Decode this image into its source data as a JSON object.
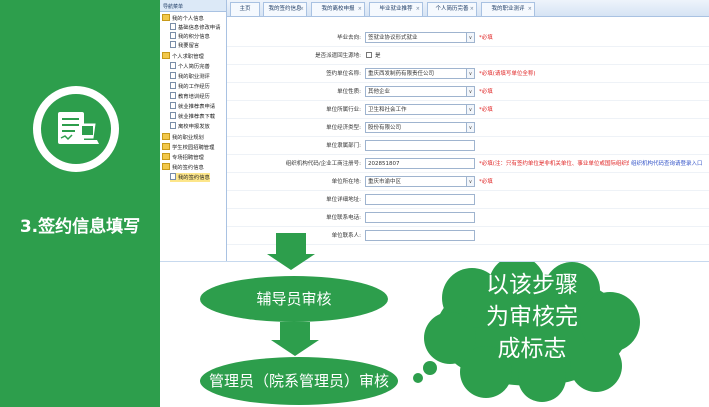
{
  "slide": {
    "step_label": "3.签约信息填写",
    "accent_color": "#2d9e4c",
    "icon": "contract-signing-icon"
  },
  "nav": {
    "header": "导航菜单",
    "items": [
      {
        "label": "我的个人信息",
        "type": "folder"
      },
      {
        "label": "基础信息修改申请",
        "type": "leaf"
      },
      {
        "label": "我的积分信息",
        "type": "leaf"
      },
      {
        "label": "我要留言",
        "type": "leaf"
      },
      {
        "label": "个人求职管理",
        "type": "folder"
      },
      {
        "label": "个人简历完善",
        "type": "leaf"
      },
      {
        "label": "我的职业测评",
        "type": "leaf"
      },
      {
        "label": "我的工作经历",
        "type": "leaf"
      },
      {
        "label": "教育培训经历",
        "type": "leaf"
      },
      {
        "label": "就业推荐表申请",
        "type": "leaf"
      },
      {
        "label": "就业推荐表下载",
        "type": "leaf"
      },
      {
        "label": "离校申报发放",
        "type": "leaf"
      },
      {
        "label": "我的职业规划",
        "type": "folder"
      },
      {
        "label": "学生校园招聘管理",
        "type": "folder"
      },
      {
        "label": "专场招聘管理",
        "type": "folder"
      },
      {
        "label": "我的签约信息",
        "type": "folder"
      },
      {
        "label": "我的签约信息",
        "type": "leaf",
        "selected": true
      }
    ]
  },
  "tabs": [
    {
      "label": "主页"
    },
    {
      "label": "我的签约信息"
    },
    {
      "label": "我的离校申报"
    },
    {
      "label": "毕业就业推荐"
    },
    {
      "label": "个人简历完善"
    },
    {
      "label": "我的职业测评"
    }
  ],
  "form": {
    "rows": [
      {
        "label": "毕业去向:",
        "value": "签就业协议形式就业",
        "dropdown": true,
        "note": "*必填"
      },
      {
        "label": "是否派遣回生源地:",
        "checkbox": true,
        "checkbox_label": "是"
      },
      {
        "label": "签约单位名称:",
        "value": "重庆西发制药有限责任公司",
        "dropdown": true,
        "note": "*必填(请填写单位全称)"
      },
      {
        "label": "单位性质:",
        "value": "其他企业",
        "dropdown": true,
        "note": "*必填"
      },
      {
        "label": "单位所属行业:",
        "value": "卫生和社会工作",
        "dropdown": true,
        "note": "*必填"
      },
      {
        "label": "单位经济类型:",
        "value": "股份有限公司",
        "dropdown": true
      },
      {
        "label": "单位隶属部门:",
        "value": ""
      },
      {
        "label": "组织机构代码/企业工商注册号:",
        "value": "202851807",
        "note": "*必填(注：只有签约单位是非机关单位、事业单位或国际组织的才可以填写\"无\"，且组织机构代码不能\"-\")",
        "link": "组织机构代码查询请登录入口"
      },
      {
        "label": "单位所在地:",
        "value": "重庆市渝中区",
        "dropdown": true,
        "note": "*必填"
      },
      {
        "label": "单位详细地址:",
        "value": ""
      },
      {
        "label": "单位联系电话:",
        "value": ""
      },
      {
        "label": "单位联系人:",
        "value": ""
      }
    ]
  },
  "flow": {
    "step1": "辅导员审核",
    "step2": "管理员（院系管理员）审核",
    "cloud_text_lines": [
      "以该步骤",
      "为审核完",
      "成标志"
    ]
  }
}
